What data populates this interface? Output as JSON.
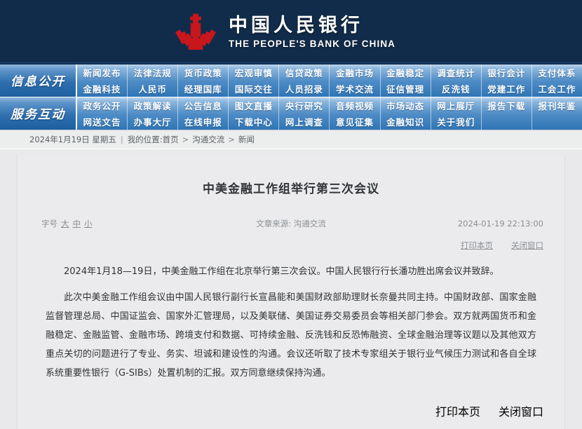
{
  "header": {
    "cn_name": "中国人民银行",
    "en_name": "THE PEOPLE'S BANK OF CHINA"
  },
  "nav": {
    "groups": [
      {
        "title": "信息公开",
        "columns": [
          {
            "top": "新闻发布",
            "bottom": "金融科技"
          },
          {
            "top": "法律法规",
            "bottom": "人民币"
          },
          {
            "top": "货币政策",
            "bottom": "经理国库"
          },
          {
            "top": "宏观审慎",
            "bottom": "国际交往"
          },
          {
            "top": "信贷政策",
            "bottom": "人员招录"
          },
          {
            "top": "金融市场",
            "bottom": "学术交流"
          },
          {
            "top": "金融稳定",
            "bottom": "征信管理"
          },
          {
            "top": "调查统计",
            "bottom": "反洗钱"
          },
          {
            "top": "银行会计",
            "bottom": "党建工作"
          },
          {
            "top": "支付体系",
            "bottom": "工会工作"
          }
        ]
      },
      {
        "title": "服务互动",
        "columns": [
          {
            "top": "政务公开",
            "bottom": "网送文告"
          },
          {
            "top": "政策解读",
            "bottom": "办事大厅"
          },
          {
            "top": "公告信息",
            "bottom": "在线申报"
          },
          {
            "top": "图文直播",
            "bottom": "下载中心"
          },
          {
            "top": "央行研究",
            "bottom": "网上调查"
          },
          {
            "top": "音频视频",
            "bottom": "意见征集"
          },
          {
            "top": "市场动态",
            "bottom": "金融知识"
          },
          {
            "top": "网上展厅",
            "bottom": "关于我们"
          },
          {
            "top": "报告下载",
            "bottom": ""
          },
          {
            "top": "报刊年鉴",
            "bottom": ""
          }
        ]
      }
    ]
  },
  "breadcrumb": {
    "date": "2024年1月19日 星期五",
    "divider": "|",
    "label": "我的位置:",
    "items": [
      "首页",
      "沟通交流",
      "新闻"
    ],
    "separator": ">"
  },
  "article": {
    "title": "中美金融工作组举行第三次会议",
    "fontsize_label": "字号",
    "fontsize_options": [
      "大",
      "中",
      "小"
    ],
    "source_label": "文章来源:",
    "source_value": "沟通交流",
    "datetime": "2024-01-19 22:13:00",
    "tools": {
      "print": "打印本页",
      "close": "关闭窗口"
    },
    "paragraphs": [
      "2024年1月18—19日，中美金融工作组在北京举行第三次会议。中国人民银行行长潘功胜出席会议并致辞。",
      "此次中美金融工作组会议由中国人民银行副行长宣昌能和美国财政部助理财长奈曼共同主持。中国财政部、国家金融监督管理总局、中国证监会、国家外汇管理局，以及美联储、美国证券交易委员会等相关部门参会。双方就两国货币和金融稳定、金融监管、金融市场、跨境支付和数据、可持续金融、反洗钱和反恐怖融资、全球金融治理等议题以及其他双方重点关切的问题进行了专业、务实、坦诚和建设性的沟通。会议还听取了技术专家组关于银行业气候压力测试和各自全球系统重要性银行（G-SIBs）处置机制的汇报。双方同意继续保持沟通。"
    ]
  },
  "colors": {
    "header_navy": "#102c4a",
    "nav_blue": "#2f75b4",
    "logo_red": "#c8161d",
    "panel_bg": "#ebebed",
    "text": "#2f3234"
  }
}
